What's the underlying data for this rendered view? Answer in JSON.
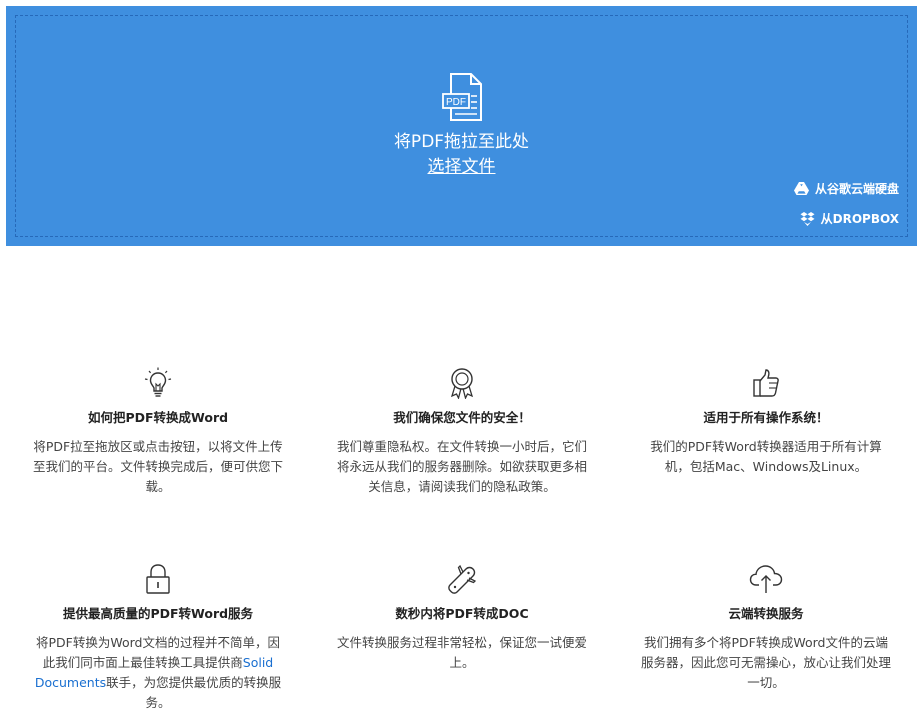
{
  "dropzone": {
    "drop_text": "将PDF拖拉至此处",
    "choose_file": "选择文件",
    "gdrive_label": "从谷歌云端硬盘",
    "dropbox_label": "从DROPBOX",
    "pdf_icon_text": "PDF",
    "background_color": "#3f8fdf"
  },
  "features": [
    {
      "icon": "lightbulb-icon",
      "title": "如何把PDF转换成Word",
      "desc": "将PDF拉至拖放区或点击按钮，以将文件上传至我们的平台。文件转换完成后，便可供您下载。"
    },
    {
      "icon": "award-icon",
      "title": "我们确保您文件的安全！",
      "desc": "我们尊重隐私权。在文件转换一小时后，它们将永远从我们的服务器删除。如欲获取更多相关信息，请阅读我们的隐私政策。"
    },
    {
      "icon": "thumbs-up-icon",
      "title": "适用于所有操作系统！",
      "desc": "我们的PDF转Word转换器适用于所有计算机，包括Mac、Windows及Linux。"
    },
    {
      "icon": "lock-icon",
      "title": "提供最高质量的PDF转Word服务",
      "desc_before": "将PDF转换为Word文档的过程并不简单，因此我们同市面上最佳转换工具提供商",
      "desc_link": "Solid Documents",
      "desc_after": "联手，为您提供最优质的转换服务。"
    },
    {
      "icon": "swiss-knife-icon",
      "title": "数秒内将PDF转成DOC",
      "desc": "文件转换服务过程非常轻松，保证您一试便爱上。"
    },
    {
      "icon": "cloud-upload-icon",
      "title": "云端转换服务",
      "desc": "我们拥有多个将PDF转换成Word文件的云端服务器，因此您可无需操心，放心让我们处理一切。"
    }
  ]
}
